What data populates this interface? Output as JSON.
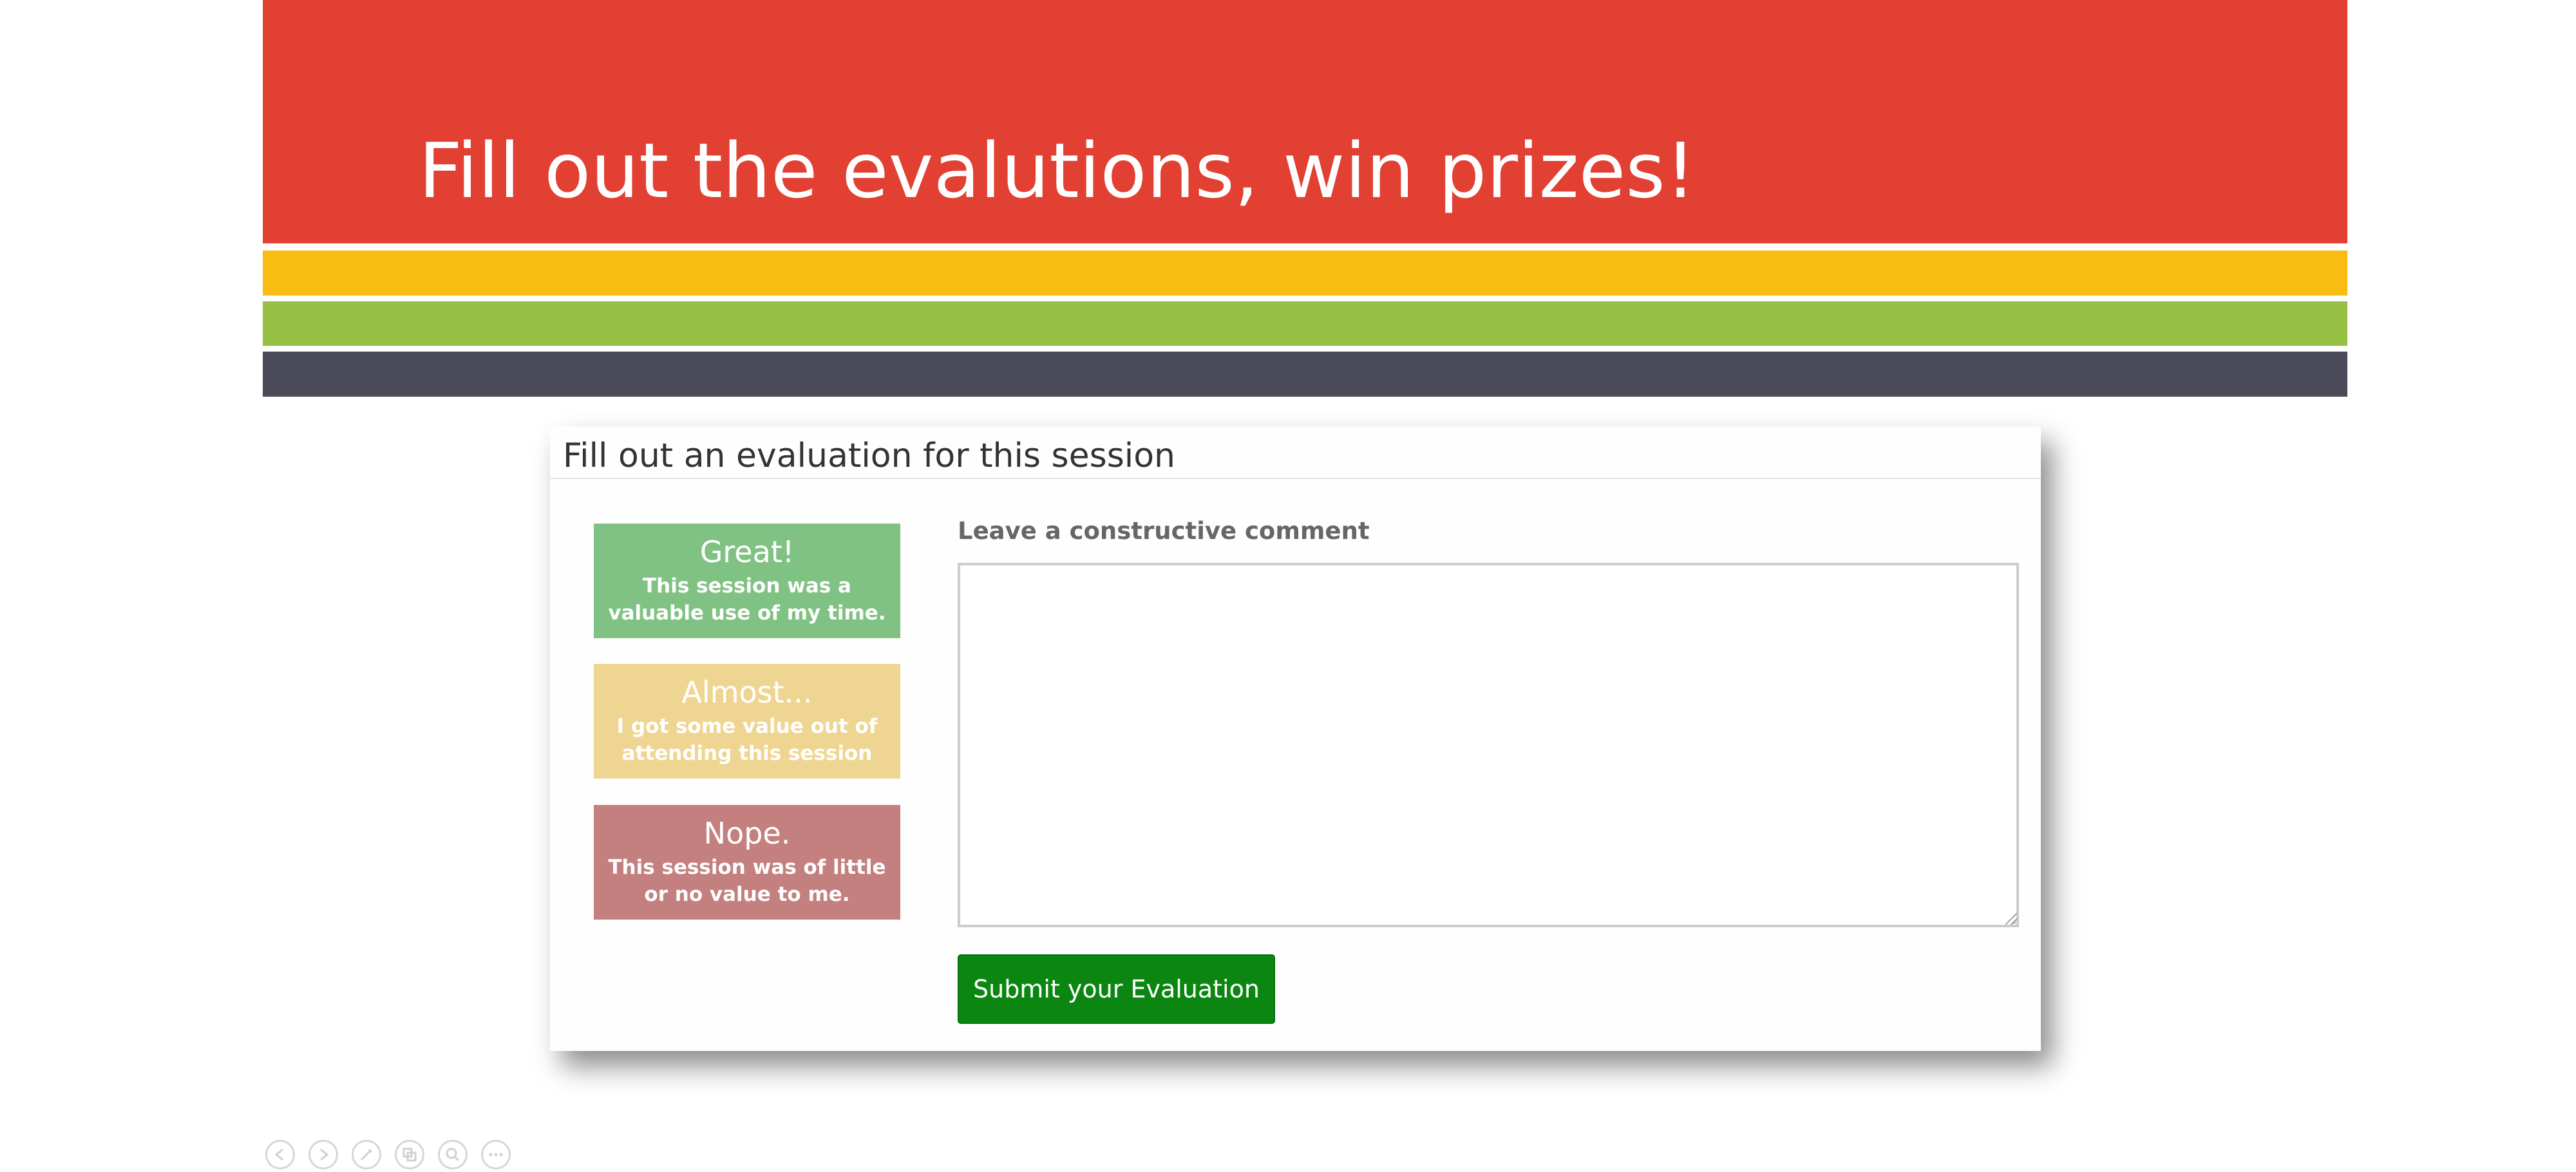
{
  "slide": {
    "title": "Fill out the evalutions, win prizes!",
    "colors": {
      "red": "#e14032",
      "yellow": "#f8bc12",
      "green": "#96c043",
      "slate": "#4a4a58"
    }
  },
  "evaluation": {
    "heading": "Fill out an evaluation for this session",
    "ratings": [
      {
        "title": "Great!",
        "description": "This session was a valuable use of my time.",
        "color": "#80c283"
      },
      {
        "title": "Almost...",
        "description": "I got some value out of attending this session",
        "color": "#eed692"
      },
      {
        "title": "Nope.",
        "description": "This session was of little or no value to me.",
        "color": "#c47f7f"
      }
    ],
    "comment_label": "Leave a constructive comment",
    "comment_value": "",
    "submit_label": "Submit your Evaluation",
    "submit_color": "#0b8711"
  },
  "controls": {
    "icons": [
      "previous-icon",
      "next-icon",
      "pen-icon",
      "slides-icon",
      "zoom-icon",
      "more-icon"
    ]
  }
}
